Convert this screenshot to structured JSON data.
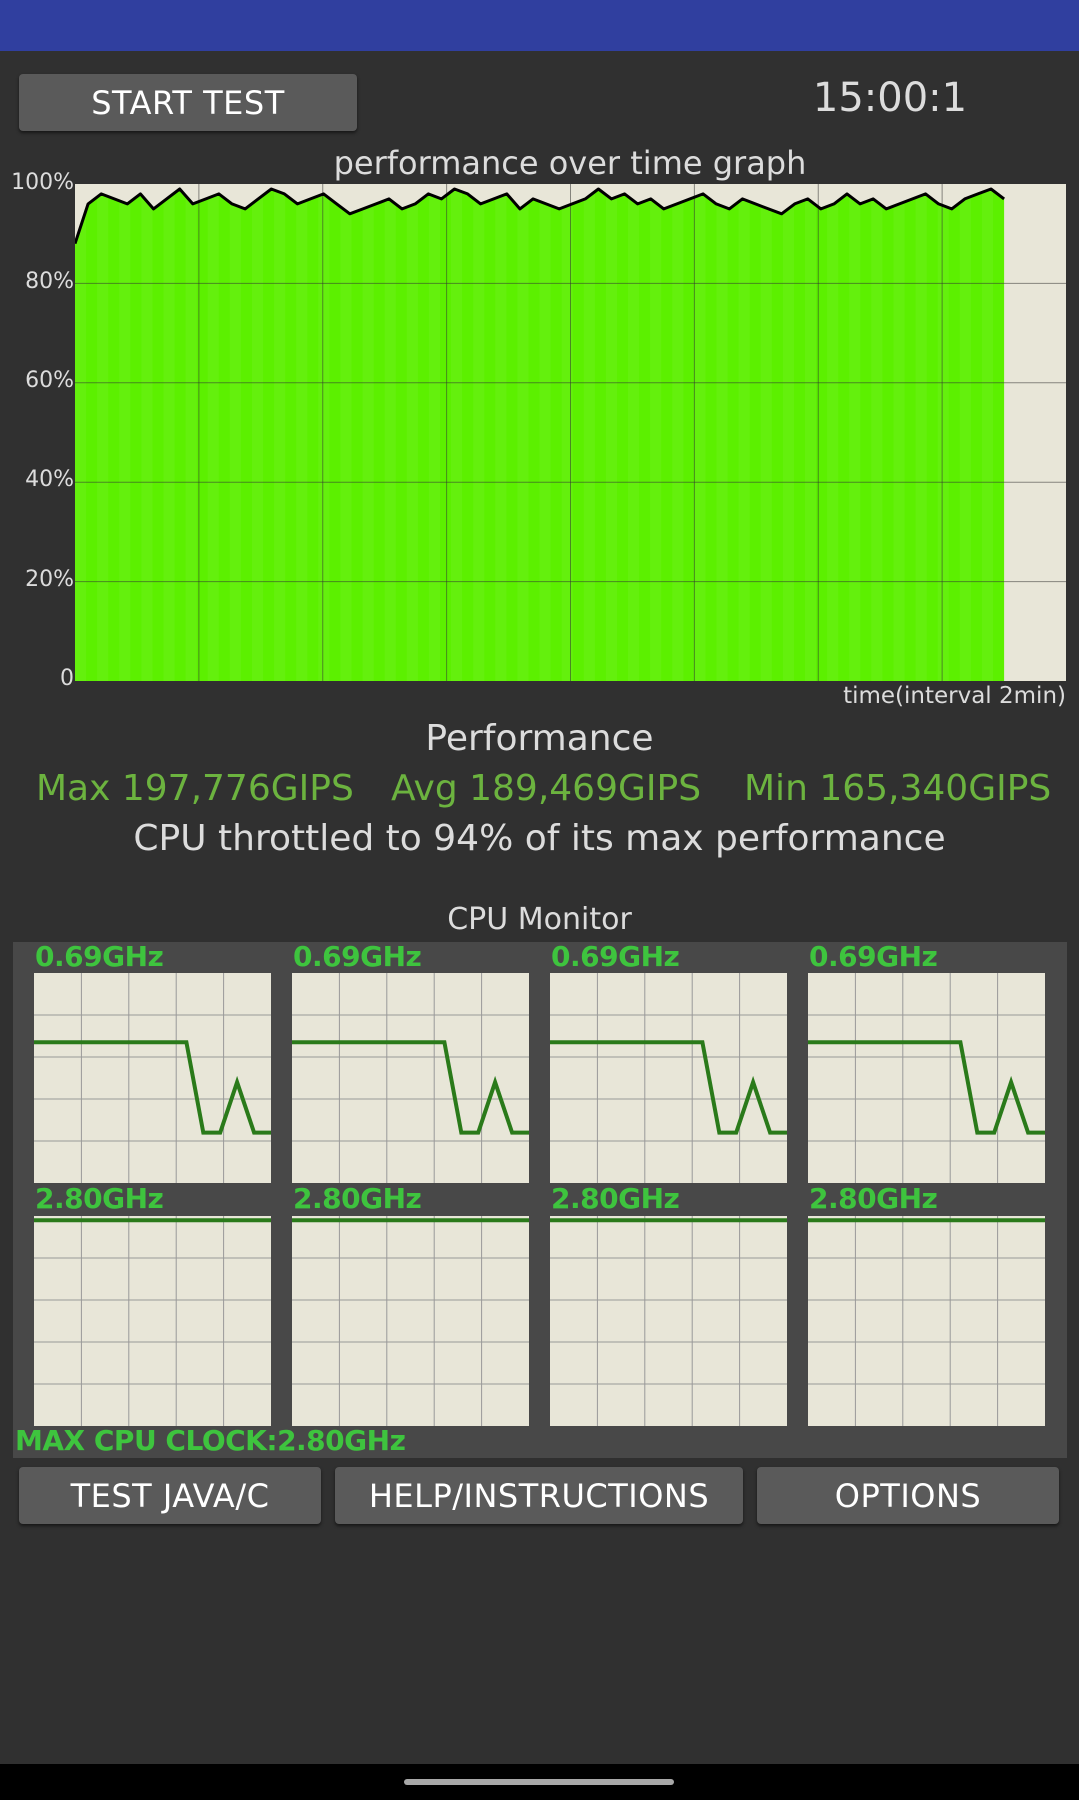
{
  "app": {
    "start_button": "START TEST",
    "timer": "15:00:1"
  },
  "graph": {
    "title": "performance over time graph",
    "y_ticks": [
      "100%",
      "80%",
      "60%",
      "40%",
      "20%",
      "0"
    ],
    "x_label": "time(interval 2min)"
  },
  "chart_data": {
    "type": "area",
    "title": "performance over time graph",
    "xlabel": "time(interval 2min)",
    "ylabel": "",
    "ylim": [
      0,
      100
    ],
    "y_ticks": [
      "0",
      "20%",
      "40%",
      "60%",
      "80%",
      "100%"
    ],
    "grid": true,
    "x_range_minutes": [
      0,
      16
    ],
    "x_data_end_minutes": 15,
    "series": [
      {
        "values": [
          88,
          96,
          98,
          97,
          96,
          98,
          95,
          97,
          99,
          96,
          97,
          98,
          96,
          95,
          97,
          99,
          98,
          96,
          97,
          98,
          96,
          94,
          95,
          96,
          97,
          95,
          96,
          98,
          97,
          99,
          98,
          96,
          97,
          98,
          95,
          97,
          96,
          95,
          96,
          97,
          99,
          97,
          98,
          96,
          97,
          95,
          96,
          97,
          98,
          96,
          95,
          97,
          96,
          95,
          94,
          96,
          97,
          95,
          96,
          98,
          96,
          97,
          95,
          96,
          97,
          98,
          96,
          95,
          97,
          98,
          99,
          97
        ]
      }
    ],
    "colors": {
      "fill": "#5cf000",
      "line": "#000000",
      "background": "#e8e6d8"
    }
  },
  "performance": {
    "heading": "Performance",
    "max": "Max 197,776GIPS",
    "avg": "Avg 189,469GIPS",
    "min": "Min 165,340GIPS",
    "throttle": "CPU throttled to 94% of its max performance"
  },
  "cpu_monitor": {
    "heading": "CPU Monitor",
    "cores": [
      {
        "freq": "0.69GHz",
        "line": [
          0.67,
          0.67,
          0.67,
          0.67,
          0.67,
          0.67,
          0.67,
          0.67,
          0.67,
          0.67,
          0.24,
          0.24,
          0.48,
          0.24,
          0.24
        ]
      },
      {
        "freq": "0.69GHz",
        "line": [
          0.67,
          0.67,
          0.67,
          0.67,
          0.67,
          0.67,
          0.67,
          0.67,
          0.67,
          0.67,
          0.24,
          0.24,
          0.48,
          0.24,
          0.24
        ]
      },
      {
        "freq": "0.69GHz",
        "line": [
          0.67,
          0.67,
          0.67,
          0.67,
          0.67,
          0.67,
          0.67,
          0.67,
          0.67,
          0.67,
          0.24,
          0.24,
          0.48,
          0.24,
          0.24
        ]
      },
      {
        "freq": "0.69GHz",
        "line": [
          0.67,
          0.67,
          0.67,
          0.67,
          0.67,
          0.67,
          0.67,
          0.67,
          0.67,
          0.67,
          0.24,
          0.24,
          0.48,
          0.24,
          0.24
        ]
      },
      {
        "freq": "2.80GHz",
        "line": [
          0.98,
          0.98
        ]
      },
      {
        "freq": "2.80GHz",
        "line": [
          0.98,
          0.98
        ]
      },
      {
        "freq": "2.80GHz",
        "line": [
          0.98,
          0.98
        ]
      },
      {
        "freq": "2.80GHz",
        "line": [
          0.98,
          0.98
        ]
      }
    ],
    "max_clock": "MAX CPU CLOCK:2.80GHz"
  },
  "buttons": {
    "test": "TEST JAVA/C",
    "help": "HELP/INSTRUCTIONS",
    "options": "OPTIONS"
  }
}
